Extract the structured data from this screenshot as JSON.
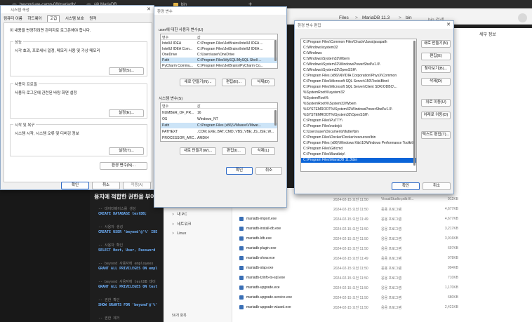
{
  "browser": {
    "tabs": [
      {
        "label": "beyond-we-camp-08/mariadb/"
      },
      {
        "label": "(4) MariaDB"
      },
      {
        "label": "bin"
      }
    ],
    "new_tab": "+"
  },
  "explorer_top": {
    "breadcrumb_files": "Files",
    "breadcrumb_mariadb": "MariaDB 11.3",
    "breadcrumb_bin": "bin",
    "search_placeholder": "bin 검색",
    "new_info": "세부 정보",
    "breadcrumb_sep": ">"
  },
  "editor": {
    "heading": "용지에 적합한 권한을 부여",
    "lines": [
      {
        "comment": "-- 데이터베이스를 생성",
        "code": "CREATE DATABASE testDB;"
      },
      {
        "comment": "-- 사용자 생성",
        "code": "CREATE USER 'beyond'@'%' IDE"
      },
      {
        "comment": "-- 사용자 확인",
        "code": "SELECT Host, User, Password"
      },
      {
        "comment": "-- beyond 사용자에 employees",
        "code": "GRANT ALL PRIVILEGES ON empl"
      },
      {
        "comment": "-- beyond 사용자에 testDB 데이",
        "code": "GRANT ALL PRIVILEGES ON test"
      },
      {
        "comment": "-- 권한 확인",
        "code": "SHOW GRANTS FOR 'beyond'@'%'"
      },
      {
        "comment": "-- 권한 제거",
        "code": ""
      }
    ]
  },
  "explorer": {
    "nav_items": [
      {
        "chev": ">",
        "label": "내 PC"
      },
      {
        "chev": ">",
        "label": "네트워크"
      },
      {
        "chev": ">",
        "label": "Linux"
      }
    ],
    "item_count": "56개 항목",
    "files": [
      {
        "name": "",
        "date": "2024-02-15 오전 11:50",
        "type": "VisualStudio.pdb.fil...",
        "size": "912KB"
      },
      {
        "name": "",
        "date": "2024-02-15 오전 11:50",
        "type": "응용 프로그램",
        "size": "4,677KB"
      },
      {
        "name": "mariadb-import.exe",
        "date": "2024-02-15 오전 11:49",
        "type": "응용 프로그램",
        "size": "4,677KB"
      },
      {
        "name": "mariadb-install-db.exe",
        "date": "2024-02-15 오전 11:50",
        "type": "응용 프로그램",
        "size": "3,217KB"
      },
      {
        "name": "mariadb-ldb.exe",
        "date": "2024-02-15 오전 11:50",
        "type": "응용 프로그램",
        "size": "3,916KB"
      },
      {
        "name": "mariadb-plugin.exe",
        "date": "2024-02-15 오전 11:50",
        "type": "응용 프로그램",
        "size": "697KB"
      },
      {
        "name": "mariadb-show.exe",
        "date": "2024-02-15 오전 11:49",
        "type": "응용 프로그램",
        "size": "978KB"
      },
      {
        "name": "mariadb-slap.exe",
        "date": "2024-02-15 오전 11:50",
        "type": "응용 프로그램",
        "size": "994KB"
      },
      {
        "name": "mariadb-tzinfo-to-sql.exe",
        "date": "2024-02-15 오전 11:50",
        "type": "응용 프로그램",
        "size": "710KB"
      },
      {
        "name": "mariadb-upgrade.exe",
        "date": "2024-02-15 오전 11:50",
        "type": "응용 프로그램",
        "size": "1,170KB"
      },
      {
        "name": "mariadb-upgrade-service.exe",
        "date": "2024-02-15 오전 11:50",
        "type": "응용 프로그램",
        "size": "680KB"
      },
      {
        "name": "mariadb-upgrade-wizard.exe",
        "date": "2024-02-15 오전 11:50",
        "type": "응용 프로그램",
        "size": "2,421KB"
      }
    ]
  },
  "sysprops": {
    "title": "시스템 속성",
    "close": "✕",
    "tabs": [
      "컴퓨터 이름",
      "하드웨어",
      "고급",
      "시스템 보호",
      "원격"
    ],
    "admin_note": "이 내용을 변경하려면 관리자로 로그온해야 합니다.",
    "groups": [
      {
        "title": "성능",
        "text": "시각 효과, 프로세서 일정, 메모리 사용 및 가상 메모리",
        "button": "설정(S)..."
      },
      {
        "title": "사용자 프로필",
        "text": "사용자 로그온에 관련된 바탕 화면 설정",
        "button": "설정(E)..."
      },
      {
        "title": "시작 및 복구",
        "text": "시스템 시작, 시스템 오류 및 디버깅 정보",
        "button": "설정(T)..."
      }
    ],
    "env_button": "환경 변수(N)...",
    "ok": "확인",
    "cancel": "취소",
    "apply": "적용(A)"
  },
  "envvars": {
    "title": "환경 변수",
    "user_label": "user에 대한 사용자 변수(U)",
    "col_var": "변수",
    "col_val": "값",
    "user_rows": [
      {
        "var": "IntelliJ IDEA",
        "val": "C:\\Program Files\\JetBrains\\IntelliJ IDEA ..."
      },
      {
        "var": "IntelliJ IDEA Com...",
        "val": "C:\\Program Files\\JetBrains\\IntelliJ IDEA ..."
      },
      {
        "var": "OneDrive",
        "val": "C:\\Users\\user\\OneDrive"
      },
      {
        "var": "Path",
        "val": "C:\\Program Files\\MySQL\\MySQL Shell ..."
      },
      {
        "var": "PyCharm Commu...",
        "val": "C:\\Program Files\\JetBrains\\PyCharm Co..."
      }
    ],
    "user_buttons": [
      "새로 만들기(N)...",
      "편집(E)...",
      "삭제(D)"
    ],
    "sys_label": "시스템 변수(S)",
    "sys_rows": [
      {
        "var": "NUMBER_OF_PR...",
        "val": "16"
      },
      {
        "var": "OS",
        "val": "Windows_NT"
      },
      {
        "var": "Path",
        "val": "C:\\Program Files (x86)\\VMware\\VMwar..."
      },
      {
        "var": "PATHEXT",
        "val": ".COM;.EXE;.BAT;.CMD;.VBS;.VBE;.JS;.JSE;.W..."
      },
      {
        "var": "PROCESSOR_ARC...",
        "val": "AMD64"
      }
    ],
    "sys_buttons": [
      "새로 만들기(W)...",
      "편집(I)...",
      "삭제(L)"
    ],
    "ok": "확인",
    "cancel": "취소"
  },
  "editenv": {
    "title": "환경 변수 편집",
    "close": "✕",
    "entries": [
      "C:\\Program Files\\Common Files\\Oracle\\Java\\javapath",
      "C:\\Windows\\system32",
      "C:\\Windows",
      "C:\\Windows\\System32\\Wbem",
      "C:\\Windows\\System32\\WindowsPowerShell\\v1.0\\",
      "C:\\Windows\\System32\\OpenSSH\\",
      "C:\\Program Files (x86)\\NVIDIA Corporation\\PhysX\\Common",
      "C:\\Program Files\\Microsoft SQL Server\\150\\Tools\\Binn\\",
      "C:\\Program Files\\Microsoft SQL Server\\Client SDK\\ODBC\\...",
      "%SystemRoot%\\system32",
      "%SystemRoot%",
      "%SystemRoot%\\System32\\Wbem",
      "%SYSTEMROOT%\\System32\\WindowsPowerShell\\v1.0\\",
      "%SYSTEMROOT%\\System32\\OpenSSH\\",
      "C:\\Program Files\\PuTTY\\",
      "C:\\Program Files\\nodejs\\",
      "C:\\Users\\user\\Documents\\flutter\\bin",
      "C:\\Program Files\\Docker\\Docker\\resources\\bin",
      "C:\\Program Files (x86)\\Windows Kits\\10\\Windows Performance Toolkit\\",
      "C:\\Program Files\\Git\\cmd",
      "C:\\Program Files\\Bandizip\\",
      "C:\\Program Files\\MariaDB 11.3\\bin"
    ],
    "selected_index": 21,
    "buttons": [
      "새로 만들기(N)",
      "편집(E)",
      "찾아보기(B)...",
      "삭제(D)",
      "위로 이동(U)",
      "아래로 이동(O)",
      "텍스트 편집(T)..."
    ],
    "ok": "확인",
    "cancel": "취소"
  }
}
